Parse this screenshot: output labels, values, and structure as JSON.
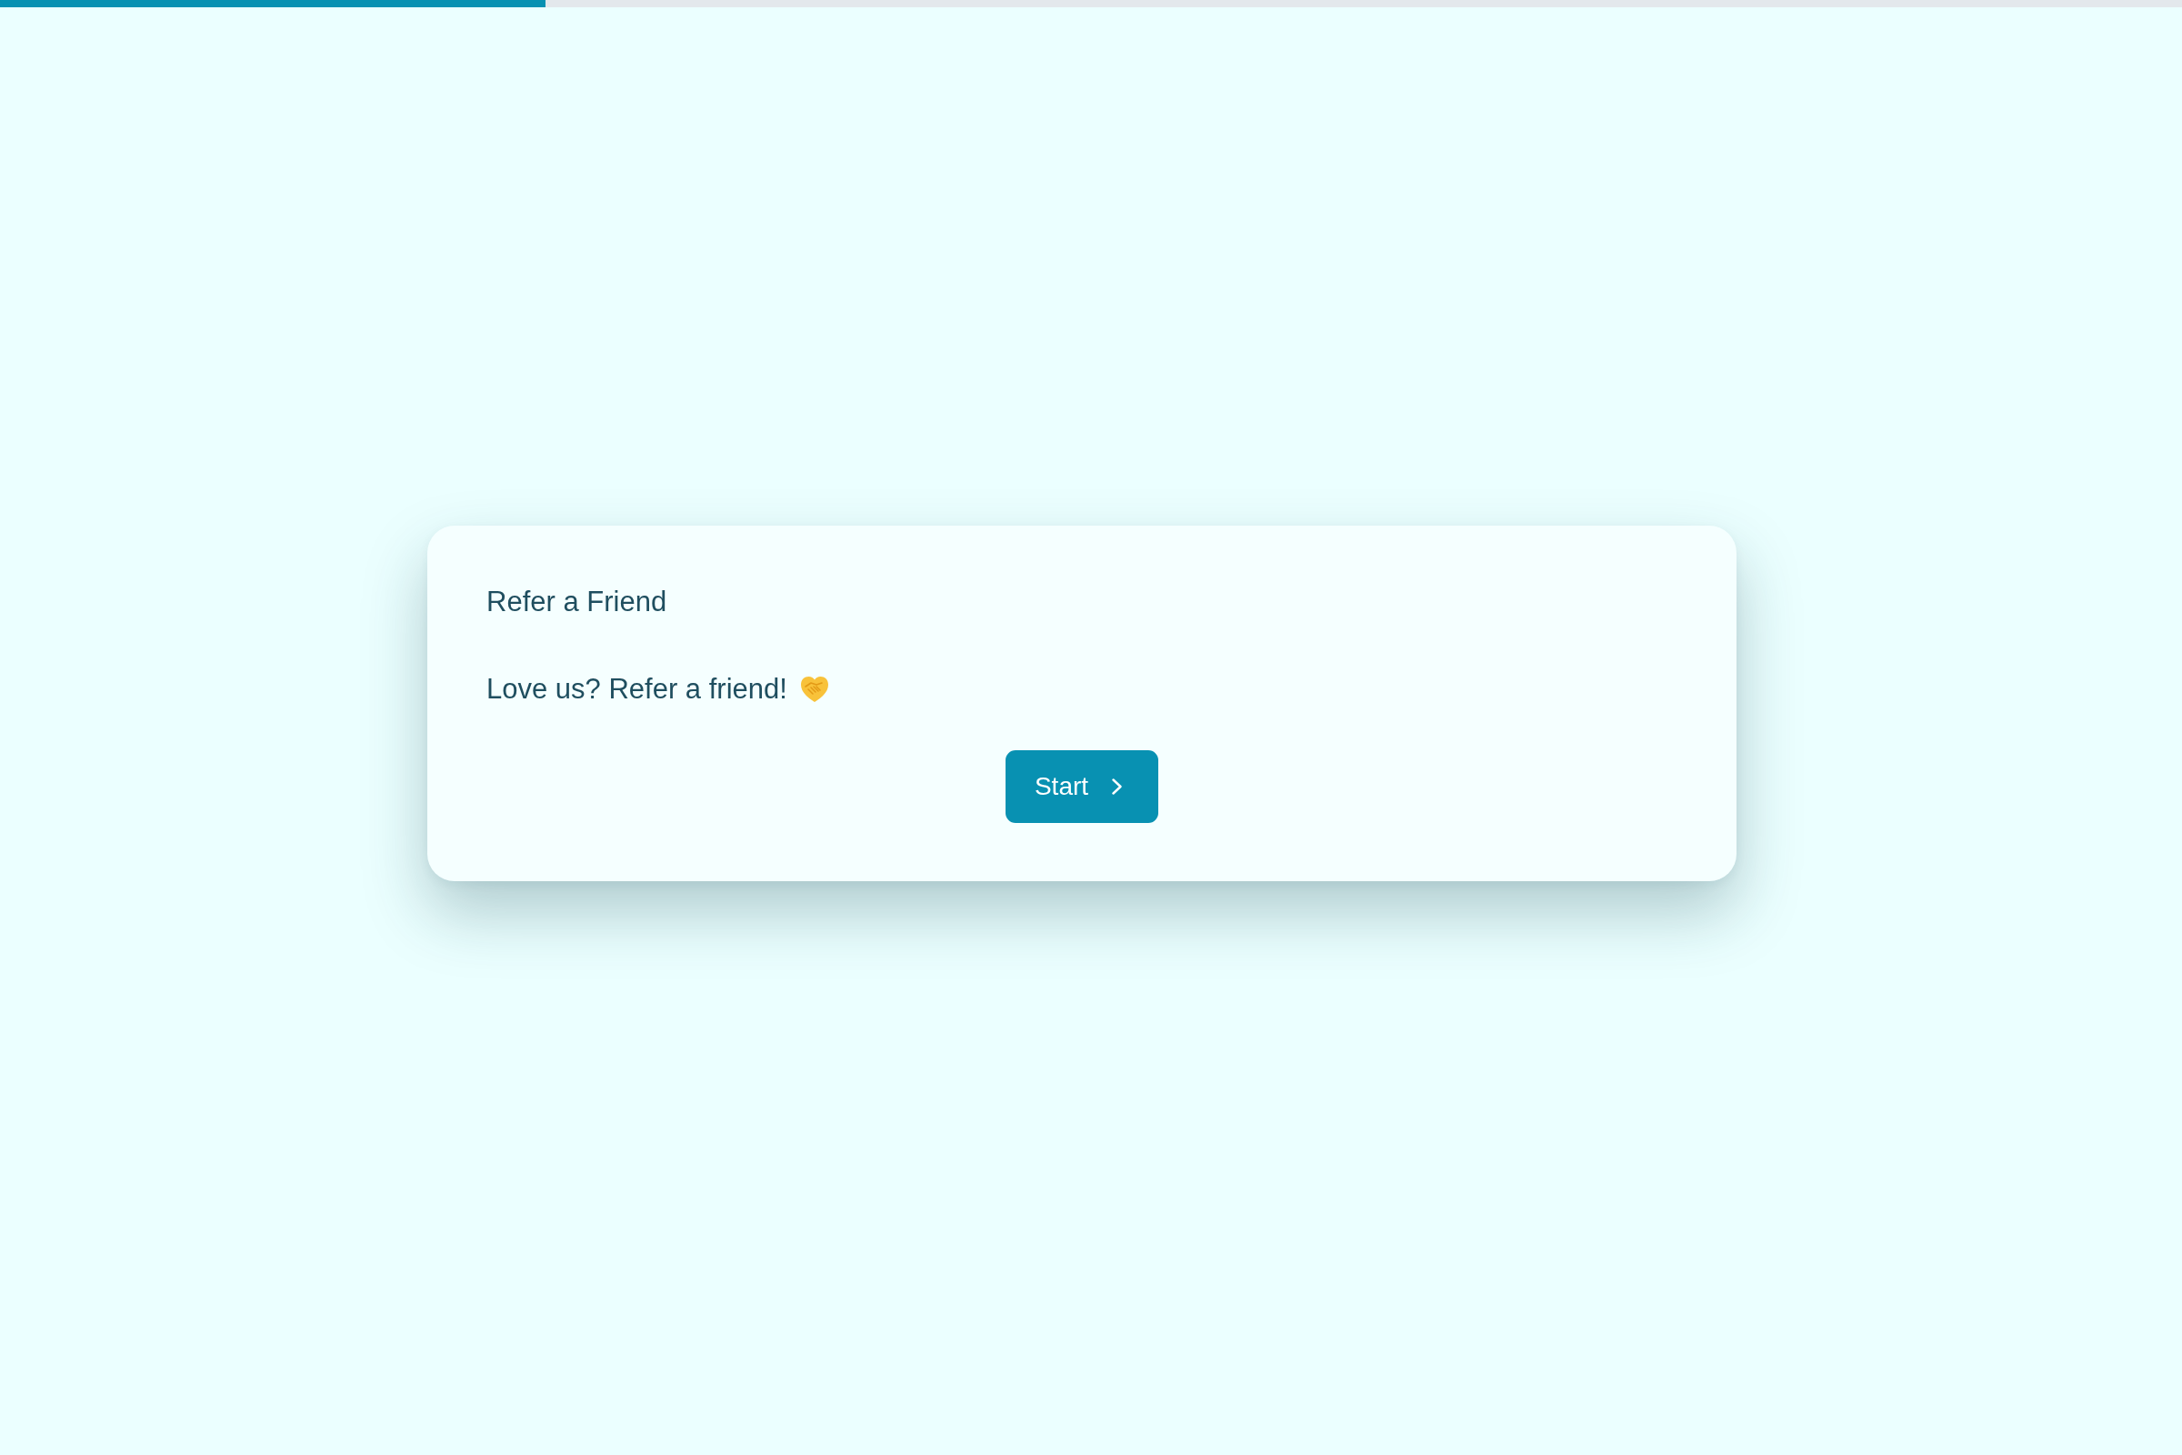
{
  "progress_bar": {
    "level": 0.25
  },
  "card": {
    "title": "Refer a Friend",
    "message": "Love us? Refer a friend!",
    "button": {
      "label": "Start"
    }
  }
}
